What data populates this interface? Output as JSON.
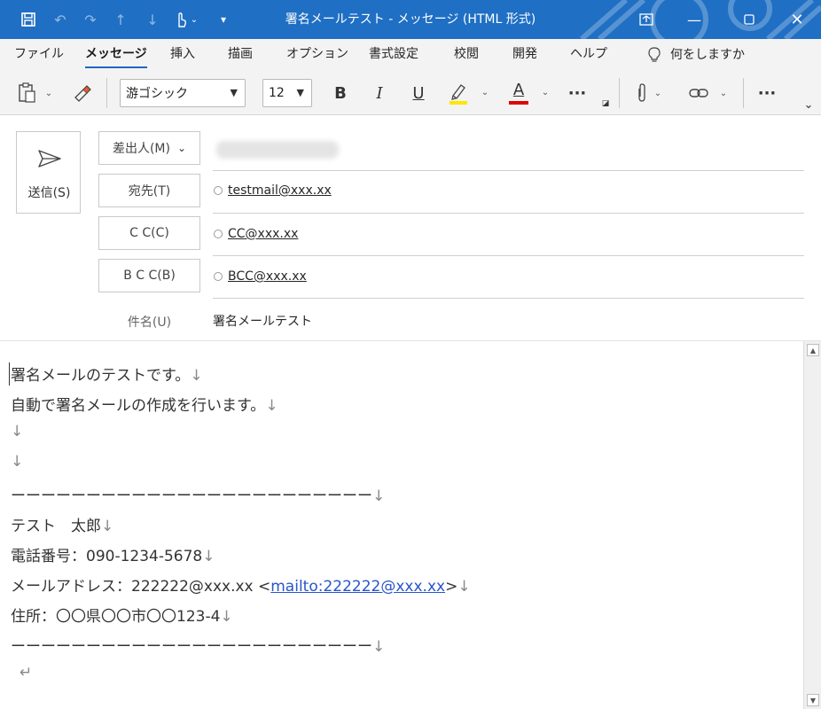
{
  "window": {
    "title": "署名メールテスト - メッセージ (HTML 形式)",
    "accent_color": "#1f6fc4"
  },
  "quick_access": {
    "icons": [
      "save-icon",
      "undo-icon",
      "redo-icon",
      "up-arrow-icon",
      "down-arrow-icon",
      "touch-mode-icon",
      "customize-icon"
    ]
  },
  "menu": {
    "tabs": [
      "ファイル",
      "メッセージ",
      "挿入",
      "描画",
      "オプション",
      "書式設定",
      "校閲",
      "開発",
      "ヘルプ"
    ],
    "active": "メッセージ",
    "search_placeholder": "何をしますか"
  },
  "ribbon": {
    "font_name": "游ゴシック",
    "font_size": "12",
    "bold": "B",
    "italic": "I",
    "underline": "U",
    "font_color_letter": "A",
    "more": "···",
    "highlight_color": "#ffe600",
    "font_color": "#e00000"
  },
  "header": {
    "send_label": "送信(S)",
    "from_label": "差出人(M)",
    "to_label": "宛先(T)",
    "cc_label": "C C(C)",
    "bcc_label": "B C C(B)",
    "subject_label": "件名(U)",
    "to_value": "testmail@xxx.xx",
    "cc_value": "CC@xxx.xx",
    "bcc_value": "BCC@xxx.xx",
    "subject_value": "署名メールテスト"
  },
  "body": {
    "lines": [
      "署名メールのテストです。",
      "自動で署名メールの作成を行います。",
      "",
      "",
      "ーーーーーーーーーーーーーーーーーーーーーーーー",
      "テスト　太郎",
      "電話番号：090-1234-5678",
      "メールアドレス：222222@xxx.xx <",
      "住所：〇〇県〇〇市〇〇123-4",
      "ーーーーーーーーーーーーーーーーーーーーーーーー"
    ],
    "mailto_link": "mailto:222222@xxx.xx",
    "email_suffix": ">",
    "line_break_mark": "↓",
    "end_mark": "↵"
  }
}
